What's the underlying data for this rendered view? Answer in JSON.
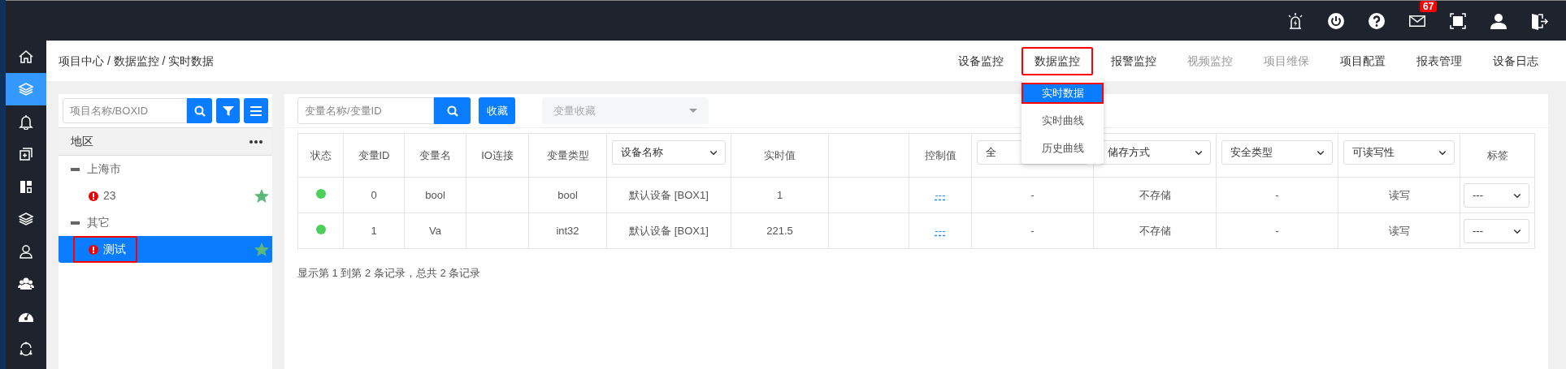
{
  "topbar": {
    "mail_badge": "67"
  },
  "sidebar": {
    "items": [
      {
        "selected": false
      },
      {
        "selected": true
      },
      {
        "selected": false
      },
      {
        "selected": false
      },
      {
        "selected": false
      },
      {
        "selected": false
      },
      {
        "selected": false
      },
      {
        "selected": false
      },
      {
        "selected": false
      },
      {
        "selected": false
      }
    ]
  },
  "breadcrumb": "项目中心 / 数据监控 / 实时数据",
  "nav": {
    "items": [
      {
        "label": "设备监控",
        "disabled": false,
        "highlighted": false
      },
      {
        "label": "数据监控",
        "disabled": false,
        "highlighted": true,
        "dropdown": [
          {
            "label": "实时数据",
            "selected": true,
            "highlighted": true
          },
          {
            "label": "实时曲线",
            "selected": false,
            "highlighted": false
          },
          {
            "label": "历史曲线",
            "selected": false,
            "highlighted": false
          }
        ]
      },
      {
        "label": "报警监控",
        "disabled": false,
        "highlighted": false
      },
      {
        "label": "视频监控",
        "disabled": true,
        "highlighted": false
      },
      {
        "label": "项目维保",
        "disabled": true,
        "highlighted": false
      },
      {
        "label": "项目配置",
        "disabled": false,
        "highlighted": false
      },
      {
        "label": "报表管理",
        "disabled": false,
        "highlighted": false
      },
      {
        "label": "设备日志",
        "disabled": false,
        "highlighted": false
      }
    ]
  },
  "project_panel": {
    "search": {
      "placeholder": "项目名称/BOXID"
    },
    "tree_header": "地区",
    "tree": [
      {
        "label": "上海市",
        "expanded": true,
        "children": [
          {
            "label": "23",
            "alert": true,
            "favorite": true,
            "selected": false,
            "highlighted": false
          }
        ]
      },
      {
        "label": "其它",
        "expanded": true,
        "children": [
          {
            "label": "测试",
            "alert": true,
            "favorite": true,
            "selected": true,
            "highlighted": true
          }
        ]
      }
    ]
  },
  "data_panel": {
    "search": {
      "placeholder": "变量名称/变量ID"
    },
    "favorite_button": "收藏",
    "favorites_select": {
      "placeholder": "变量收藏",
      "disabled": true
    },
    "table": {
      "columns": [
        {
          "kind": "text",
          "label": "状态"
        },
        {
          "kind": "text",
          "label": "变量ID"
        },
        {
          "kind": "text",
          "label": "变量名"
        },
        {
          "kind": "text",
          "label": "IO连接"
        },
        {
          "kind": "text",
          "label": "变量类型"
        },
        {
          "kind": "select",
          "label": "设备名称"
        },
        {
          "kind": "text",
          "label": "实时值"
        },
        {
          "kind": "blank"
        },
        {
          "kind": "text",
          "label": "控制值"
        },
        {
          "kind": "select",
          "label": "全"
        },
        {
          "kind": "select",
          "label": "储存方式"
        },
        {
          "kind": "select",
          "label": "安全类型"
        },
        {
          "kind": "select",
          "label": "可读写性"
        },
        {
          "kind": "text",
          "label": "标签"
        }
      ],
      "rows": [
        {
          "cells": [
            {
              "kind": "dot",
              "online": true
            },
            {
              "kind": "text",
              "text": "0"
            },
            {
              "kind": "text",
              "text": "bool"
            },
            {
              "kind": "empty"
            },
            {
              "kind": "text",
              "text": "bool"
            },
            {
              "kind": "text",
              "text": "默认设备 [BOX1]"
            },
            {
              "kind": "text",
              "text": "1"
            },
            {
              "kind": "empty"
            },
            {
              "kind": "link",
              "text": "---"
            },
            {
              "kind": "text",
              "text": "-"
            },
            {
              "kind": "text",
              "text": "不存储"
            },
            {
              "kind": "text",
              "text": "-"
            },
            {
              "kind": "text",
              "text": "读写"
            },
            {
              "kind": "select",
              "text": "---"
            }
          ]
        },
        {
          "cells": [
            {
              "kind": "dot",
              "online": true
            },
            {
              "kind": "text",
              "text": "1"
            },
            {
              "kind": "text",
              "text": "Va"
            },
            {
              "kind": "empty"
            },
            {
              "kind": "text",
              "text": "int32"
            },
            {
              "kind": "text",
              "text": "默认设备 [BOX1]"
            },
            {
              "kind": "text",
              "text": "221.5"
            },
            {
              "kind": "empty"
            },
            {
              "kind": "link",
              "text": "---"
            },
            {
              "kind": "text",
              "text": "-"
            },
            {
              "kind": "text",
              "text": "不存储"
            },
            {
              "kind": "text",
              "text": "-"
            },
            {
              "kind": "text",
              "text": "读写"
            },
            {
              "kind": "select",
              "text": "---"
            }
          ]
        }
      ]
    },
    "footer": "显示第 1 到第 2 条记录，总共 2 条记录"
  }
}
